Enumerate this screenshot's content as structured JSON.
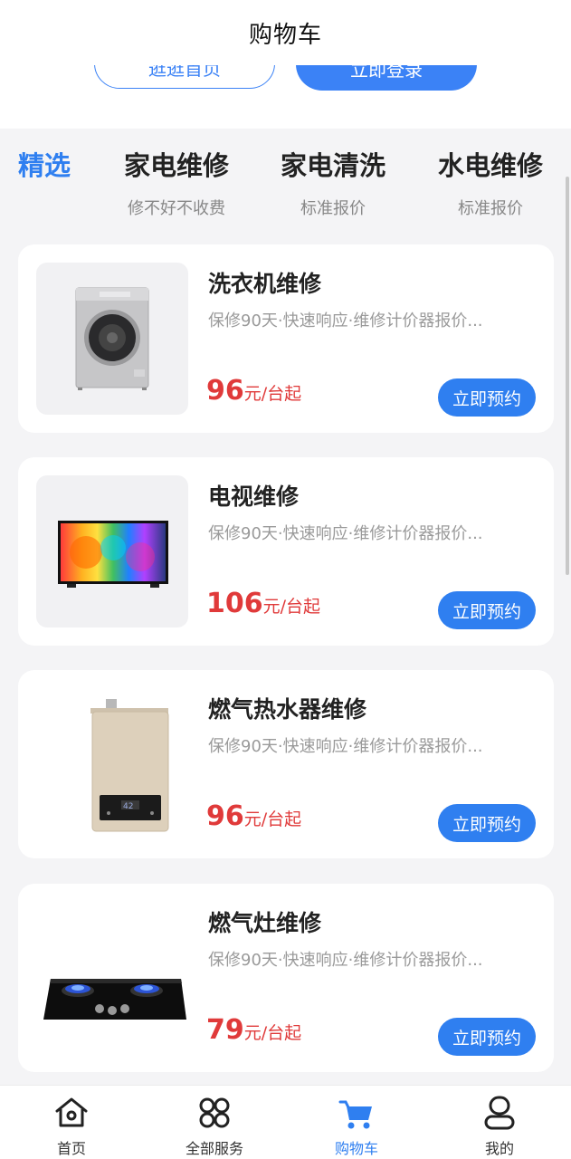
{
  "header": {
    "title": "购物车"
  },
  "top_buttons": {
    "home_label": "逛逛首页",
    "login_label": "立即登录"
  },
  "tabs": [
    {
      "title": "精选",
      "subtitle": ""
    },
    {
      "title": "家电维修",
      "subtitle": "修不好不收费"
    },
    {
      "title": "家电清洗",
      "subtitle": "标准报价"
    },
    {
      "title": "水电维修",
      "subtitle": "标准报价"
    }
  ],
  "products": [
    {
      "title": "洗衣机维修",
      "desc": "保修90天·快速响应·维修计价器报价...",
      "price": "96",
      "unit": "元/台起",
      "button": "立即预约",
      "image": "washing-machine"
    },
    {
      "title": "电视维修",
      "desc": "保修90天·快速响应·维修计价器报价...",
      "price": "106",
      "unit": "元/台起",
      "button": "立即预约",
      "image": "television"
    },
    {
      "title": "燃气热水器维修",
      "desc": "保修90天·快速响应·维修计价器报价...",
      "price": "96",
      "unit": "元/台起",
      "button": "立即预约",
      "image": "gas-water-heater"
    },
    {
      "title": "燃气灶维修",
      "desc": "保修90天·快速响应·维修计价器报价...",
      "price": "79",
      "unit": "元/台起",
      "button": "立即预约",
      "image": "gas-stove"
    }
  ],
  "bottom_nav": [
    {
      "label": "首页",
      "icon": "home-icon"
    },
    {
      "label": "全部服务",
      "icon": "grid-icon"
    },
    {
      "label": "购物车",
      "icon": "cart-icon"
    },
    {
      "label": "我的",
      "icon": "profile-icon"
    }
  ],
  "colors": {
    "accent": "#2f7ff0",
    "price": "#e03a3a",
    "background": "#f4f4f6"
  }
}
